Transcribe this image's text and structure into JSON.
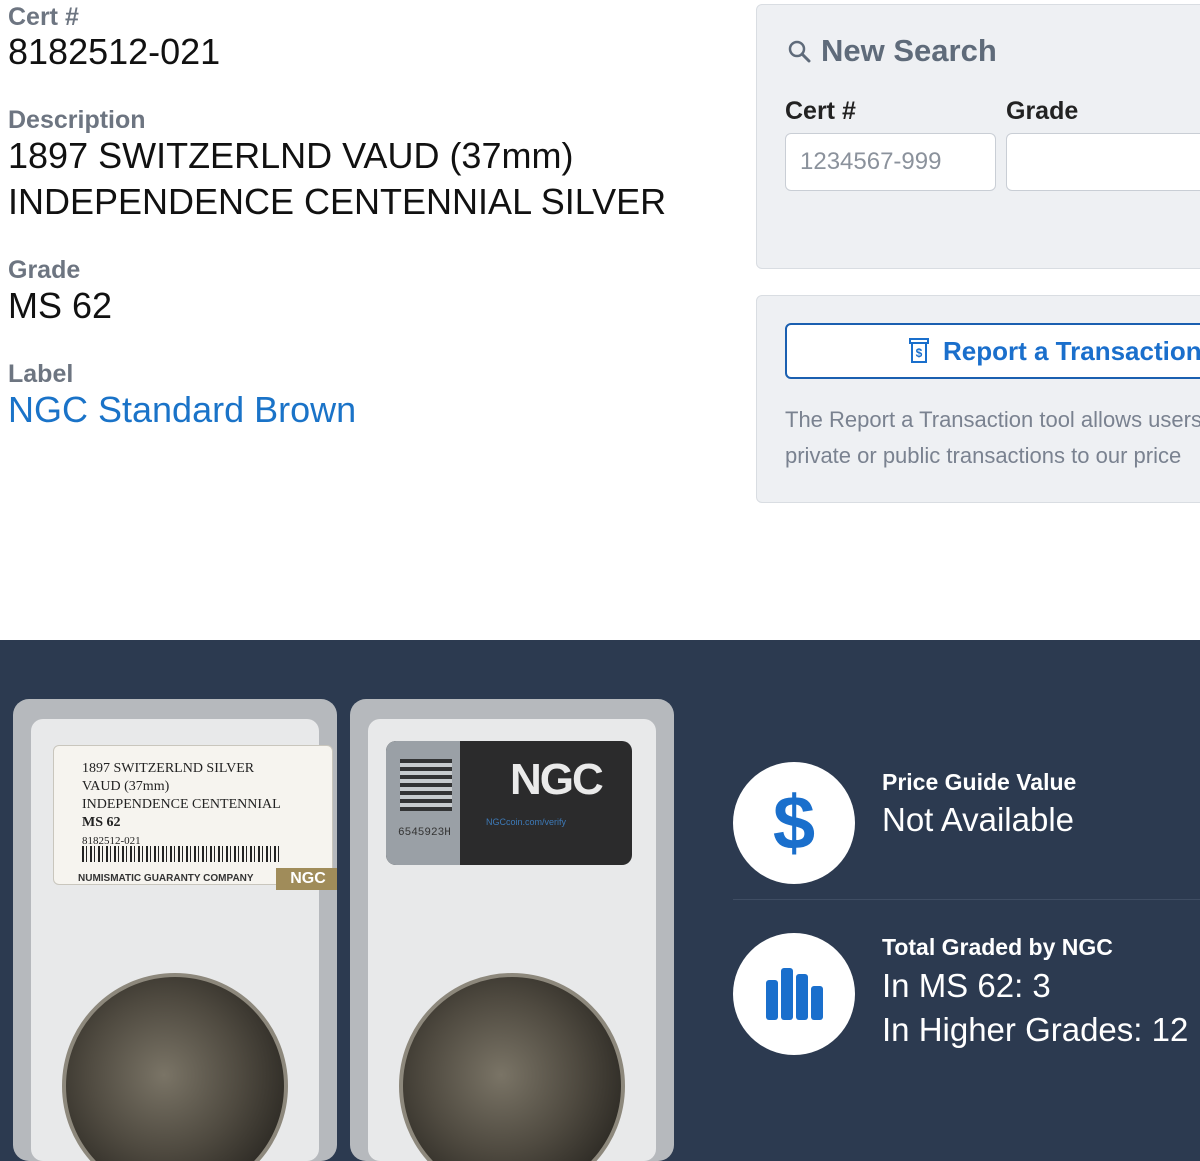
{
  "details": {
    "cert_label": "Cert #",
    "cert_value": "8182512-021",
    "description_label": "Description",
    "description_line1": "1897 SWITZERLND VAUD (37mm)",
    "description_line2": "INDEPENDENCE CENTENNIAL SILVER",
    "grade_label": "Grade",
    "grade_value": "MS 62",
    "label_label": "Label",
    "label_value": "NGC Standard Brown"
  },
  "search": {
    "icon": "search-icon",
    "title": "New Search",
    "cert_label": "Cert #",
    "cert_placeholder": "1234567-999",
    "grade_label": "Grade",
    "grade_value": ""
  },
  "report": {
    "icon": "receipt-dollar-icon",
    "button_label": "Report a Transaction",
    "description_line1": "The Report a Transaction tool allows users",
    "description_line2": "private or public transactions to our price"
  },
  "slab_label": {
    "line1": "1897 SWITZERLND SILVER",
    "line2": "VAUD (37mm)",
    "line3": "INDEPENDENCE CENTENNIAL",
    "line4": "MS 62",
    "line5": "8182512-021",
    "company": "NUMISMATIC GUARANTY COMPANY",
    "badge": "NGC"
  },
  "slab_back": {
    "serial": "6545923H",
    "logo": "NGC",
    "url": "NGCcoin.com/verify"
  },
  "stats": {
    "price_icon": "dollar-icon",
    "price_title": "Price Guide Value",
    "price_value": "Not Available",
    "graded_icon": "bar-chart-icon",
    "graded_title": "Total Graded by NGC",
    "graded_in_grade": "In MS 62: 3",
    "graded_higher": "In Higher Grades: 12"
  },
  "colors": {
    "accent_blue": "#1a6fcc",
    "dark_section": "#2c3a50",
    "panel_bg": "#eef0f3"
  }
}
